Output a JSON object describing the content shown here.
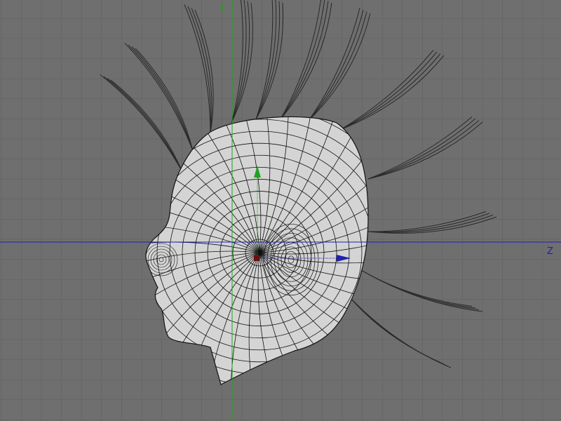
{
  "viewport": {
    "axis_y_label": "Y",
    "axis_z_label": "Z",
    "colors": {
      "background": "#6f6f6f",
      "grid": "#5d5d5d",
      "axis_y": "#1fa31f",
      "axis_z": "#2020b0",
      "mesh_fill": "#d4d4d4",
      "mesh_wire": "#111111",
      "hair": "#2a2a2a",
      "pivot": "#6a1010"
    }
  }
}
